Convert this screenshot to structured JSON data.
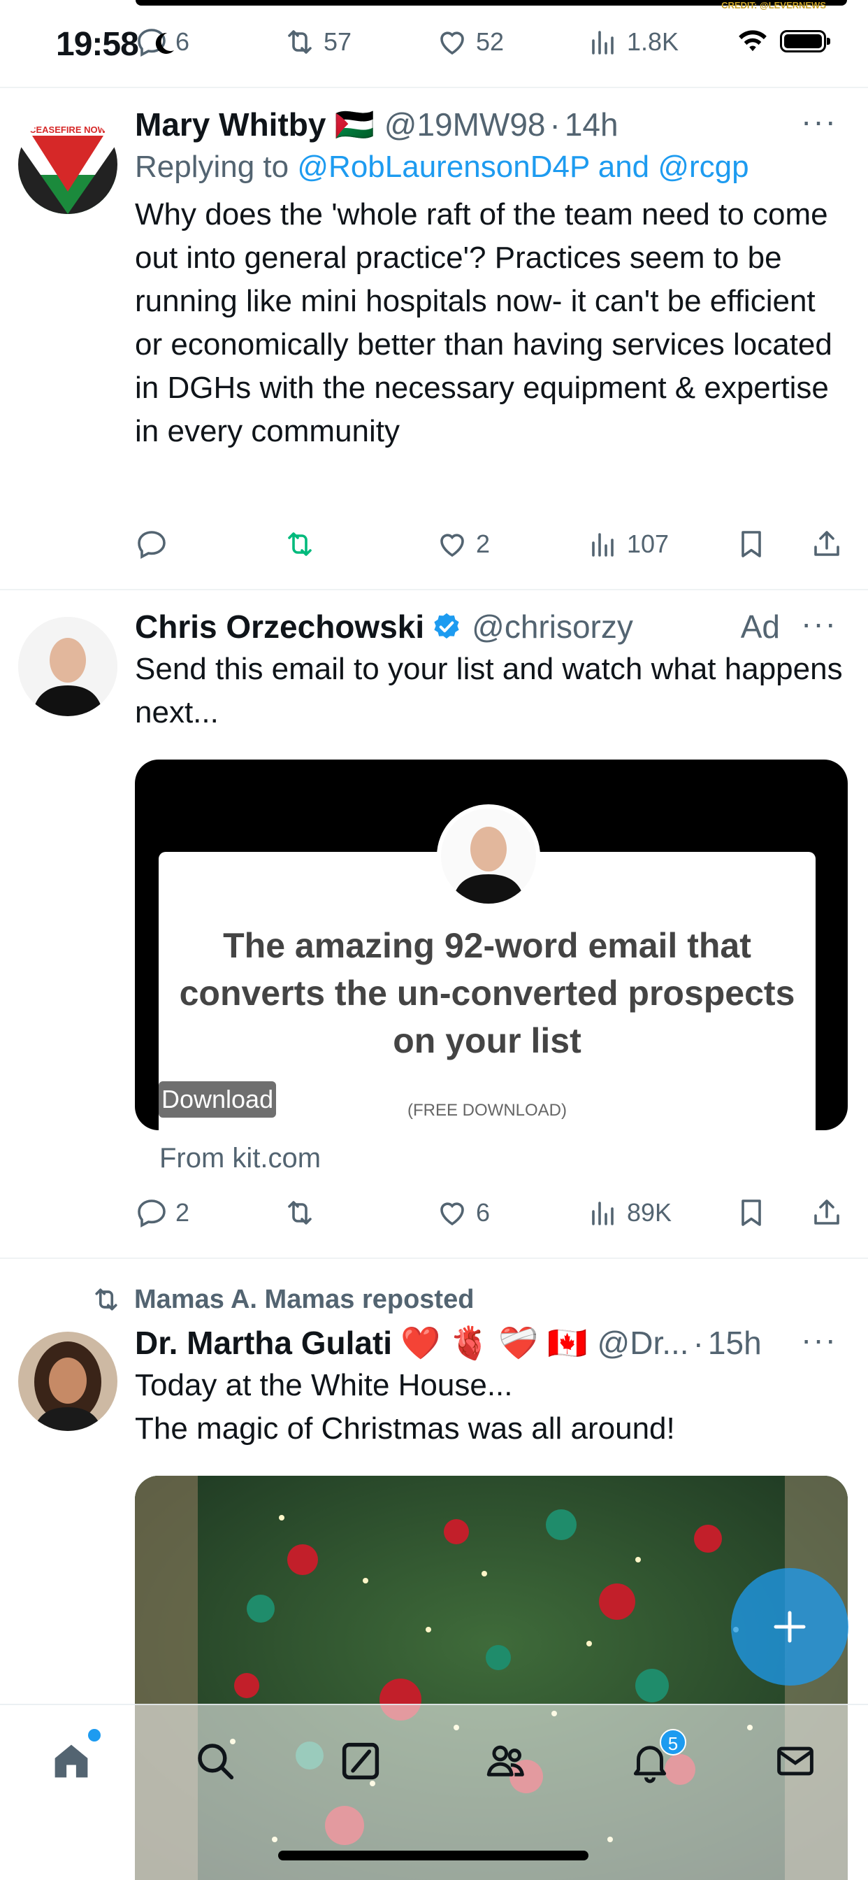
{
  "status_bar": {
    "time": "19:58",
    "prev_counts": {
      "replies": "6",
      "reposts": "57",
      "likes": "52",
      "views": "1.8K"
    },
    "prev_credit": "CREDIT: @LEVERNEWS"
  },
  "tweets": [
    {
      "name": "Mary Whitby",
      "flag": "🇵🇸",
      "handle": "@19MW98",
      "time": "14h",
      "reply_prefix": "Replying to",
      "reply_to": "@RobLaurensonD4P and @rcgp",
      "text": "Why does the 'whole raft of the team need to come out into general practice'? Practices seem to be running like mini hospitals now- it can't be efficient or economically better than having services located in DGHs with the necessary equipment & expertise in every community",
      "replies": "",
      "reposts": "",
      "likes": "2",
      "views": "107",
      "avatar_text": "CEASEFIRE NOW"
    },
    {
      "name": "Chris Orzechowski",
      "handle": "@chrisorzy",
      "ad_label": "Ad",
      "text": "Send this email to your list and watch what happens next...",
      "card": {
        "headline": "The amazing 92-word email that converts the un-converted prospects on your list",
        "subtext": "(FREE DOWNLOAD)",
        "download_label": "Download",
        "source": "From kit.com"
      },
      "replies": "2",
      "reposts": "",
      "likes": "6",
      "views": "89K"
    },
    {
      "reposted_by": "Mamas A. Mamas reposted",
      "name": "Dr. Martha Gulati",
      "emojis": "❤️ 🫀 ❤️‍🩹 🇨🇦",
      "handle": "@Dr...",
      "time": "15h",
      "text_line1": "Today at the White House...",
      "text_line2": "The magic of Christmas was all around!"
    }
  ],
  "tab_bar": {
    "notification_count": "5"
  },
  "colors": {
    "accent": "#1d9bf0",
    "repost_green": "#00ba7c",
    "secondary_text": "#536471"
  }
}
